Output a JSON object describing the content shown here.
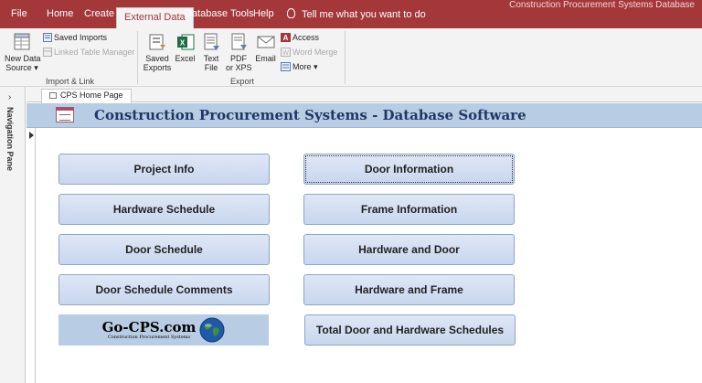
{
  "window": {
    "title": "Construction Procurement Systems Database"
  },
  "tabs": [
    {
      "label": "File"
    },
    {
      "label": "Home"
    },
    {
      "label": "Create"
    },
    {
      "label": "External Data"
    },
    {
      "label": "Database Tools"
    },
    {
      "label": "Help"
    }
  ],
  "tellme": {
    "label": "Tell me what you want to do"
  },
  "ribbon": {
    "import_group": {
      "label": "Import & Link",
      "new_data_source": {
        "line1": "New Data",
        "line2": "Source"
      },
      "saved_imports": "Saved Imports",
      "linked_table_manager": "Linked Table Manager"
    },
    "export_group": {
      "label": "Export",
      "saved_exports": {
        "line1": "Saved",
        "line2": "Exports"
      },
      "excel": "Excel",
      "text_file": {
        "line1": "Text",
        "line2": "File"
      },
      "pdf_xps": {
        "line1": "PDF",
        "line2": "or XPS"
      },
      "email": "Email",
      "access": "Access",
      "word_merge": "Word Merge",
      "more": "More"
    }
  },
  "nav_pane": {
    "label": "Navigation Pane"
  },
  "document_tab": {
    "label": "CPS Home Page"
  },
  "form": {
    "title": "Construction Procurement Systems - Database Software",
    "buttons_left": [
      "Project Info",
      "Hardware Schedule",
      "Door Schedule",
      "Door Schedule Comments"
    ],
    "buttons_right": [
      "Door Information",
      "Frame Information",
      "Hardware and Door",
      "Hardware and Frame",
      "Total Door and Hardware Schedules"
    ],
    "logo": {
      "main": "Go-CPS.com",
      "sub": "Construction Procurement Systems"
    }
  }
}
